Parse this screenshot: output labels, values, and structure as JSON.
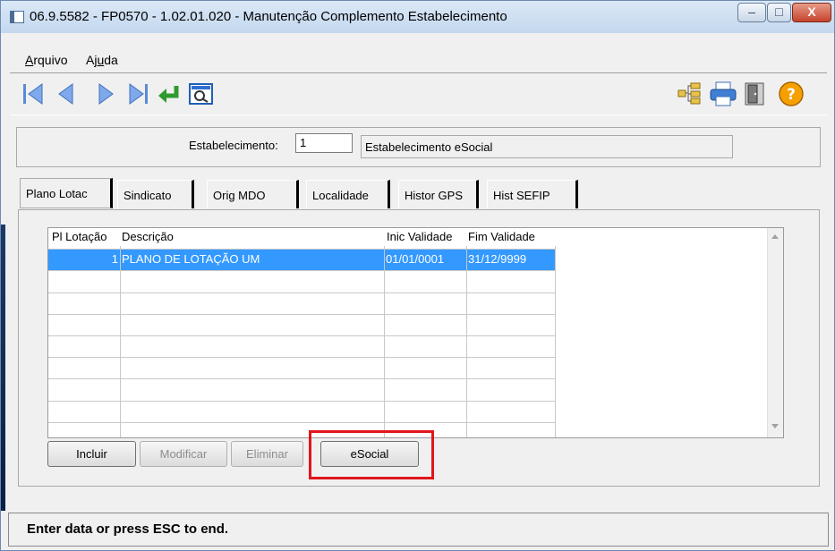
{
  "window": {
    "title": "06.9.5582 - FP0570 - 1.02.01.020 - Manutenção Complemento Estabelecimento",
    "controls": {
      "minimize": "–",
      "maximize": "□",
      "close": "X"
    }
  },
  "menu": {
    "arquivo": "Arquivo",
    "ajuda": "Ajuda"
  },
  "toolbar_icons": [
    "first-icon",
    "previous-icon",
    "next-icon",
    "last-icon",
    "goto-icon",
    "search-icon",
    "tree-icon",
    "print-icon",
    "exit-icon",
    "help-icon"
  ],
  "header": {
    "estab_label": "Estabelecimento:",
    "estab_code": "1",
    "estab_desc": "Estabelecimento eSocial"
  },
  "tabs": [
    "Plano Lotac",
    "Sindicato",
    "Orig MDO",
    "Localidade",
    "Histor GPS",
    "Hist SEFIP"
  ],
  "grid": {
    "columns": [
      "Pl Lotação",
      "Descrição",
      "Inic Validade",
      "Fim Validade"
    ],
    "rows": [
      [
        "1",
        "PLANO DE LOTAÇÃO UM",
        "01/01/0001",
        "31/12/9999"
      ]
    ]
  },
  "buttons": {
    "incluir": "Incluir",
    "modificar": "Modificar",
    "eliminar": "Eliminar",
    "esocial": "eSocial"
  },
  "status": "Enter data or press ESC to end.",
  "colors": {
    "selection": "#3399ff",
    "highlight": "#e0161c",
    "help": "#f5a000"
  }
}
